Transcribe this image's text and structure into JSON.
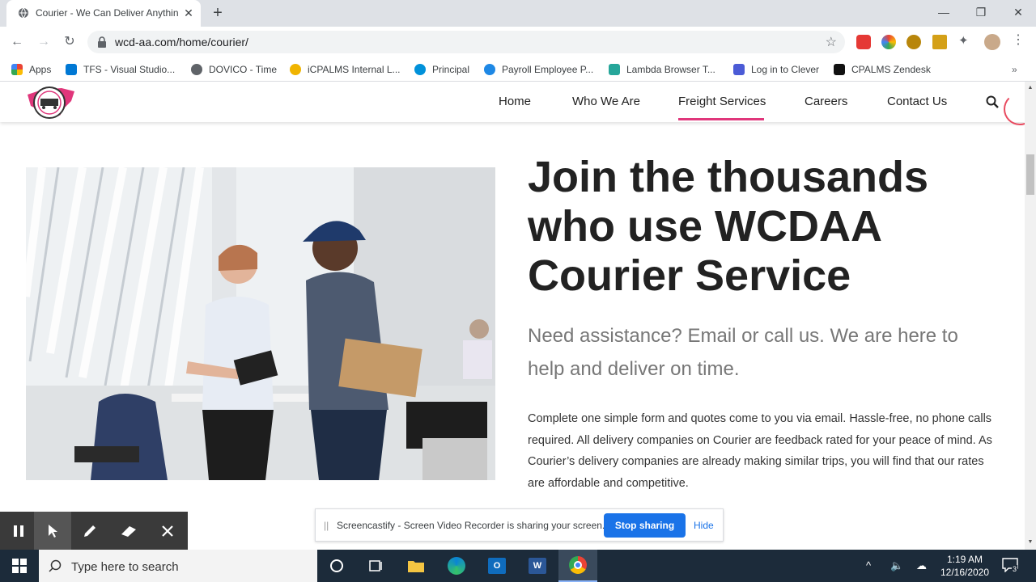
{
  "browser": {
    "tab_title": "Courier - We Can Deliver Anythin",
    "url": "wcd-aa.com/home/courier/",
    "bookmarks": [
      {
        "label": "Apps"
      },
      {
        "label": "TFS - Visual Studio..."
      },
      {
        "label": "DOVICO - Time"
      },
      {
        "label": "iCPALMS Internal L..."
      },
      {
        "label": "Principal"
      },
      {
        "label": "Payroll Employee P..."
      },
      {
        "label": "Lambda Browser T..."
      },
      {
        "label": "Log in to Clever"
      },
      {
        "label": "CPALMS Zendesk"
      }
    ]
  },
  "site": {
    "nav": [
      {
        "label": "Home"
      },
      {
        "label": "Who We Are"
      },
      {
        "label": "Freight Services"
      },
      {
        "label": "Careers"
      },
      {
        "label": "Contact Us"
      }
    ],
    "active_nav": "Freight Services",
    "accent_color": "#e0367b",
    "headline": "Join the thousands who use WCDAA Courier Service",
    "subheadline": "Need assistance? Email or call us. We are here to help and deliver on time.",
    "body": "Complete one simple form and quotes come to you via email. Hassle-free, no phone calls required. All delivery companies on Courier are feedback rated for your peace of mind. As Courier’s delivery companies are already making similar trips, you will find that our rates are affordable and competitive."
  },
  "screencastify": {
    "message": "Screencastify - Screen Video Recorder is sharing your screen.",
    "stop_label": "Stop sharing",
    "hide_label": "Hide"
  },
  "taskbar": {
    "search_placeholder": "Type here to search",
    "time": "1:19 AM",
    "date": "12/16/2020",
    "notification_count": "3"
  }
}
